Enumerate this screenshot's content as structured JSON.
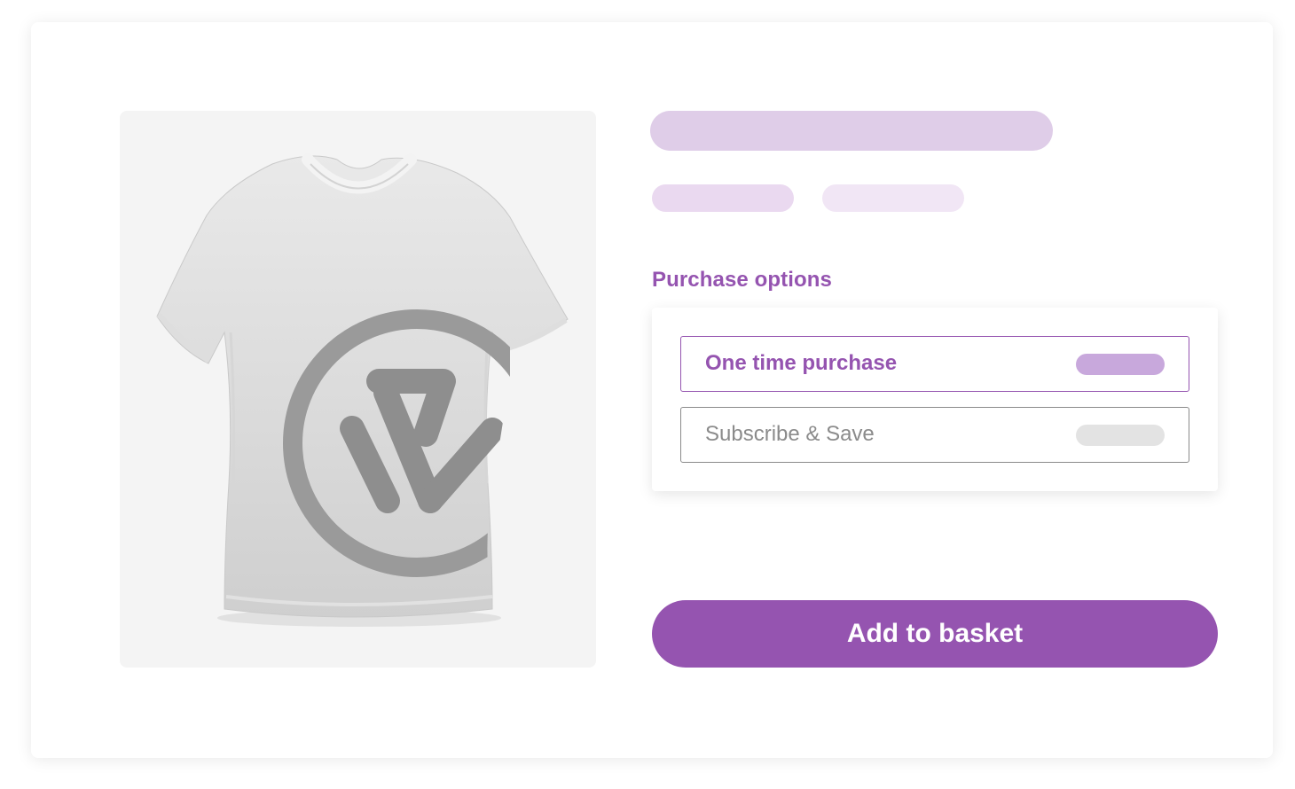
{
  "product": {
    "image_alt": "white t-shirt with logo"
  },
  "purchase": {
    "section_label": "Purchase options",
    "options": [
      {
        "label": "One time purchase",
        "selected": true
      },
      {
        "label": "Subscribe & Save",
        "selected": false
      }
    ]
  },
  "actions": {
    "add_to_basket_label": "Add to basket"
  },
  "colors": {
    "accent": "#9554b0",
    "skeleton_title": "#dfcde8",
    "skeleton_meta": "#ead9f0",
    "option_pill_selected": "#c8a8dc",
    "option_pill_unselected": "#e3e3e3"
  }
}
